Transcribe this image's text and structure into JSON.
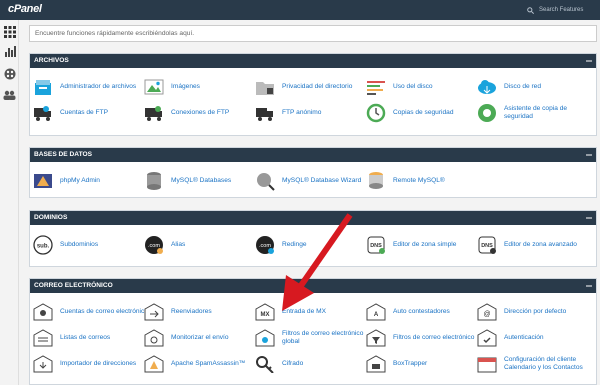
{
  "app": {
    "logo": "cPanel",
    "search_placeholder": "Search Features"
  },
  "main_search": {
    "placeholder": "Encuentre funciones rápidamente escribiéndolas aquí."
  },
  "sections": [
    {
      "title": "ARCHIVOS",
      "items": [
        "Administrador de archivos",
        "Imágenes",
        "Privacidad del directorio",
        "Uso del disco",
        "Disco de red",
        "Cuentas de FTP",
        "Conexiones de FTP",
        "FTP anónimo",
        "Copias de seguridad",
        "Asistente de copia de seguridad"
      ]
    },
    {
      "title": "BASES DE DATOS",
      "items": [
        "phpMy Admin",
        "MySQL® Databases",
        "MySQL® Database Wizard",
        "Remote MySQL®"
      ]
    },
    {
      "title": "DOMINIOS",
      "items": [
        "Subdominios",
        "Alias",
        "Redinge",
        "Editor de zona simple",
        "Editor de zona avanzado"
      ]
    },
    {
      "title": "CORREO ELECTRÓNICO",
      "items": [
        "Cuentas de correo electrónico",
        "Reenviadores",
        "Entrada de MX",
        "Auto contestadores",
        "Dirección por defecto",
        "Listas de correos",
        "Monitorizar el envío",
        "Filtros de correo electrónico global",
        "Filtros de correo electrónico",
        "Autenticación",
        "Importador de direcciones",
        "Apache SpamAssassin™",
        "Cifrado",
        "BoxTrapper",
        "Configuración del cliente Calendario y los Contactos"
      ]
    }
  ],
  "colors": {
    "topbar": "#293a4a",
    "link": "#1b73c4",
    "arrow": "#d71920"
  }
}
